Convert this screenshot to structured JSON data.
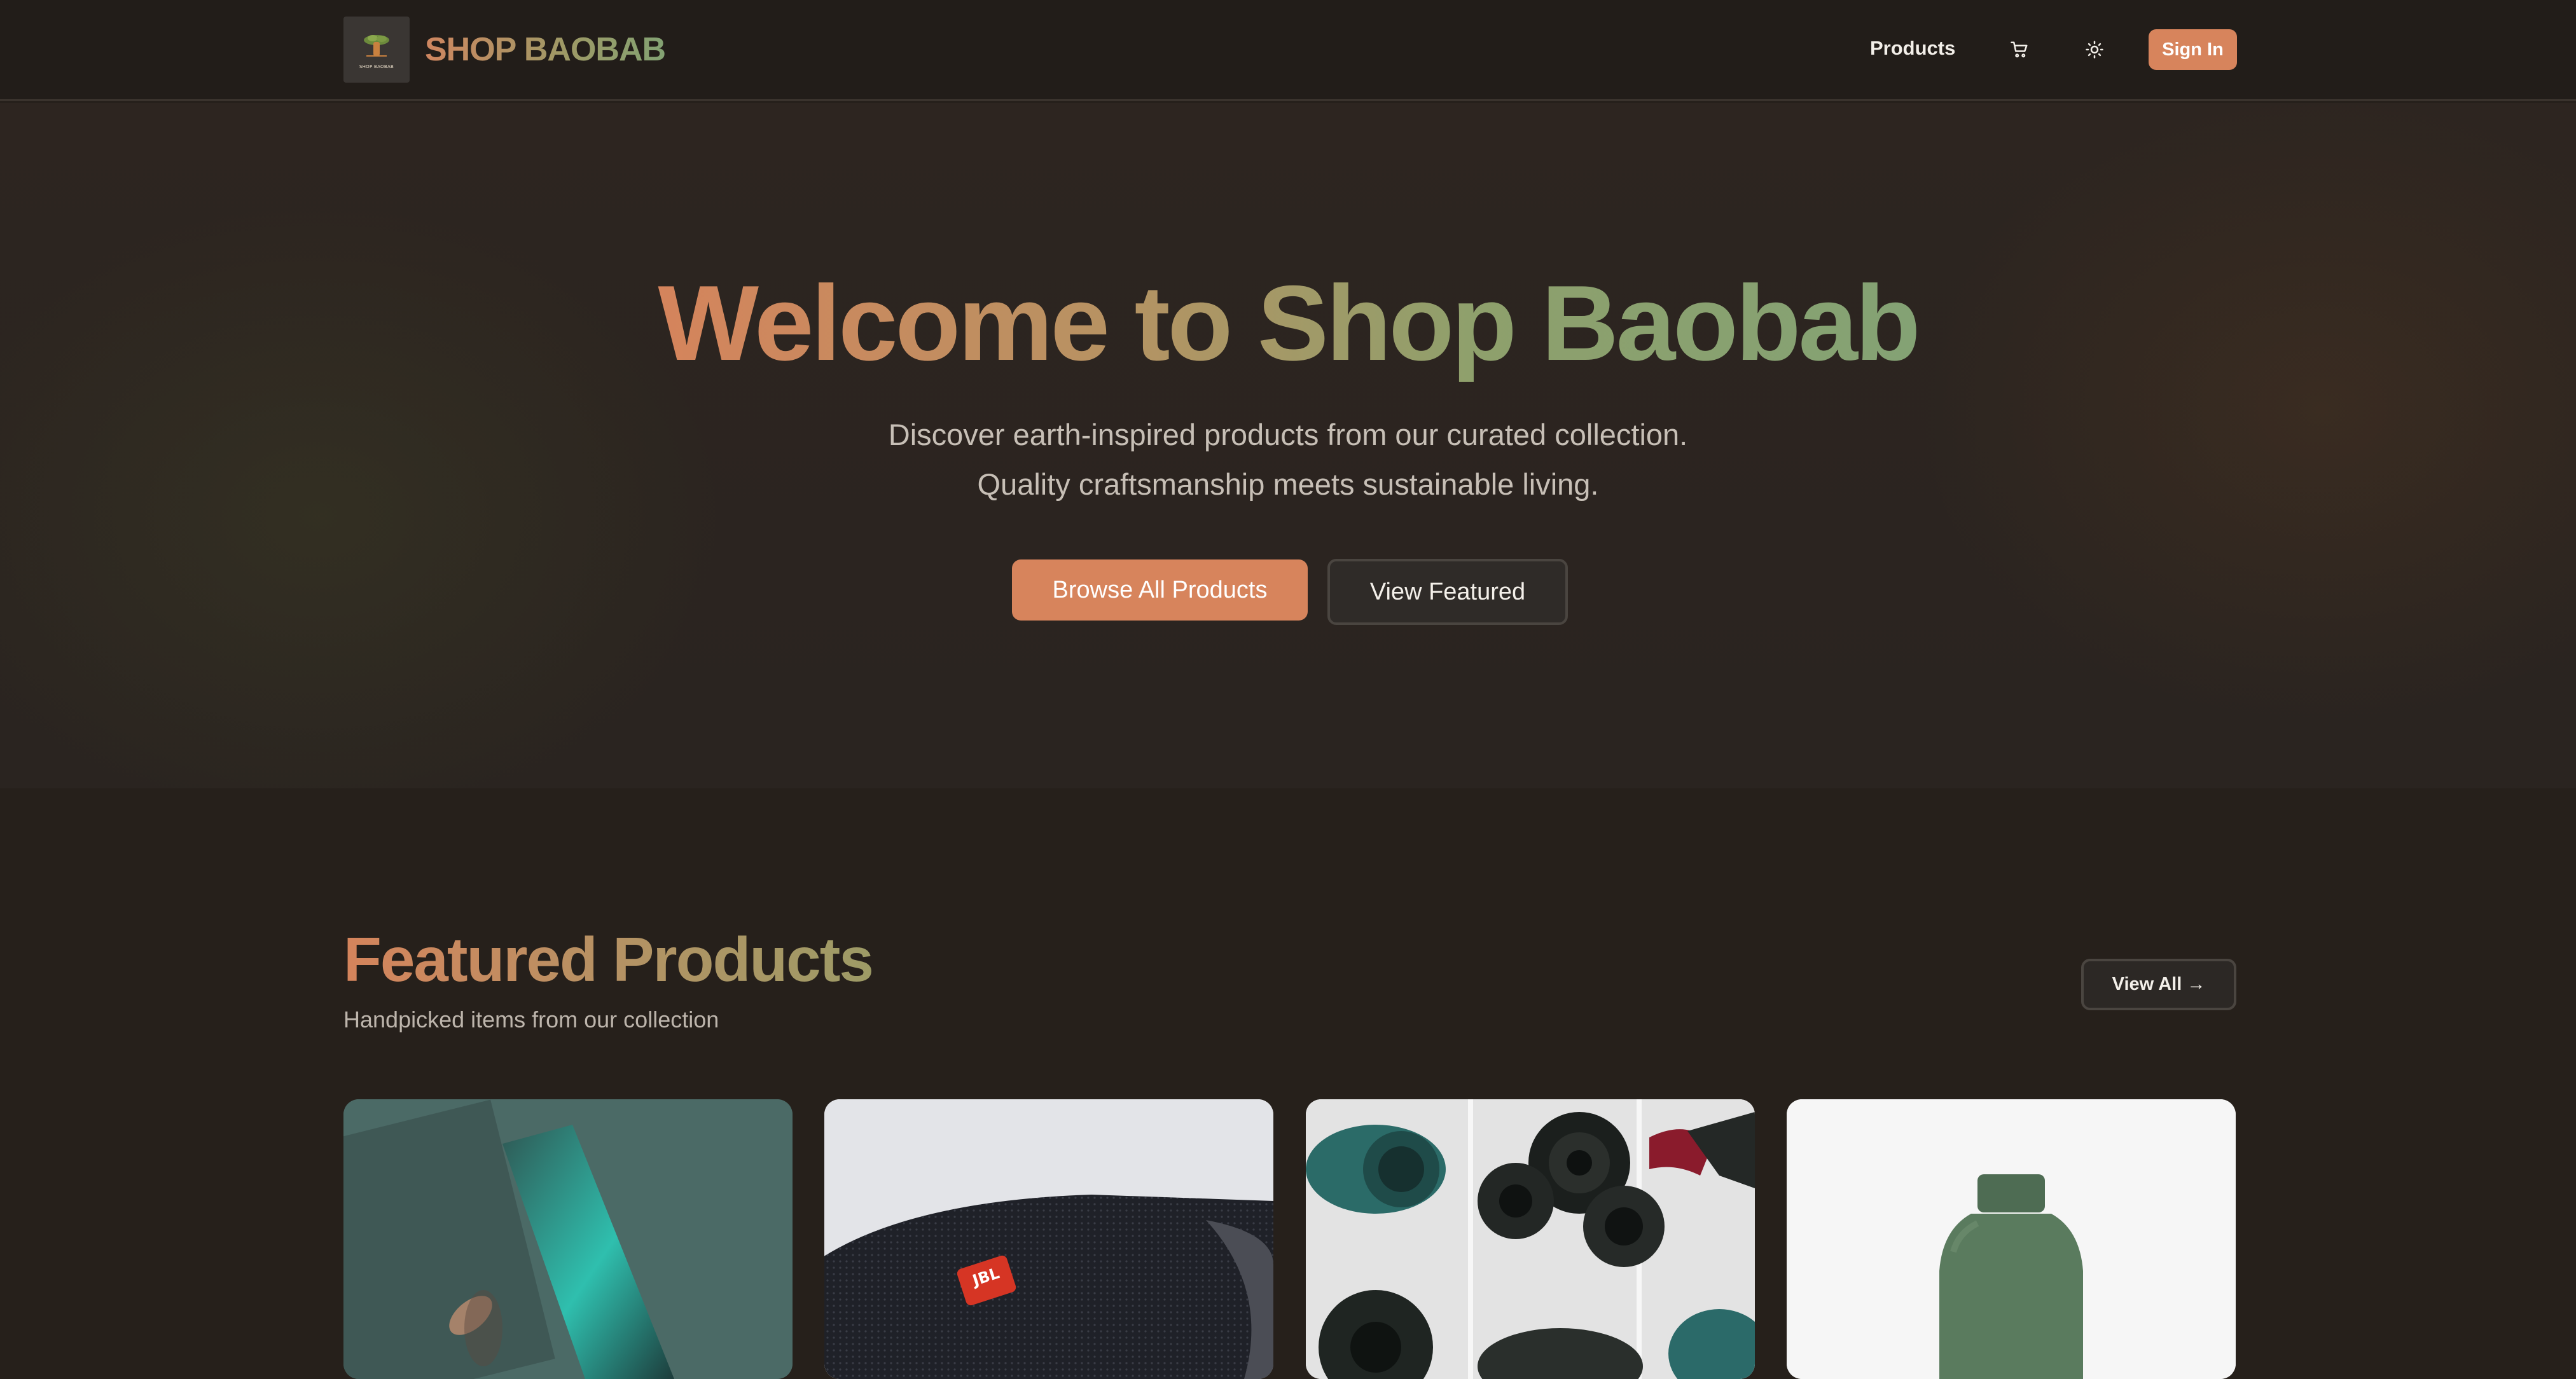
{
  "header": {
    "brand": "SHOP BAOBAB",
    "logo_text": "SHOP BAOBAB",
    "nav": [
      {
        "label": "Products"
      }
    ],
    "cart_icon": "cart-icon",
    "theme_icon": "sun-icon",
    "signin_label": "Sign In"
  },
  "hero": {
    "title": "Welcome to Shop Baobab",
    "subtitle_line1": "Discover earth-inspired products from our curated collection.",
    "subtitle_line2": "Quality craftsmanship meets sustainable living.",
    "primary_button": "Browse All Products",
    "secondary_button": "View Featured"
  },
  "featured": {
    "title": "Featured Products",
    "subtitle": "Handpicked items from our collection",
    "view_all": "View All →",
    "products": [
      {
        "image": "smartphone-in-hand"
      },
      {
        "image": "jbl-speaker",
        "brand_text": "JBL"
      },
      {
        "image": "rolled-yoga-mats"
      },
      {
        "image": "green-water-bottle"
      }
    ]
  },
  "colors": {
    "accent": "#d7845c",
    "green": "#84a274",
    "background": "#26201b"
  }
}
